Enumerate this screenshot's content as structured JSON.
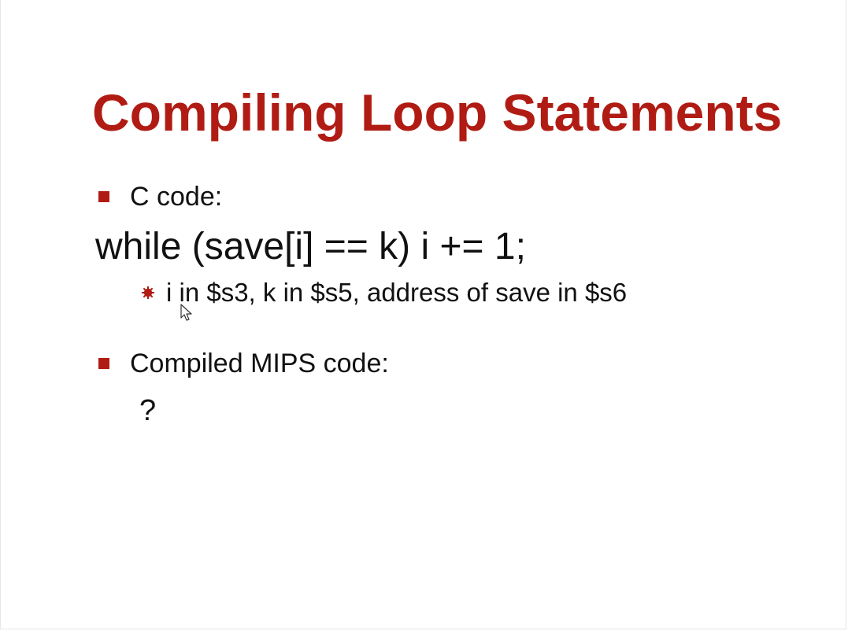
{
  "slide": {
    "title": "Compiling Loop Statements",
    "bullets": [
      {
        "label": "C code:"
      },
      {
        "label": "Compiled MIPS code:"
      }
    ],
    "code_line": "while (save[i] == k) i += 1;",
    "sub_bullet": "i in $s3, k in $s5, address of save in $s6",
    "answer": "?"
  },
  "colors": {
    "accent": "#b01c14",
    "text": "#111111",
    "background": "#ffffff"
  },
  "icons": {
    "level1_bullet": "square-bullet-icon",
    "level2_bullet": "star-bullet-icon",
    "pointer": "mouse-cursor-icon"
  }
}
